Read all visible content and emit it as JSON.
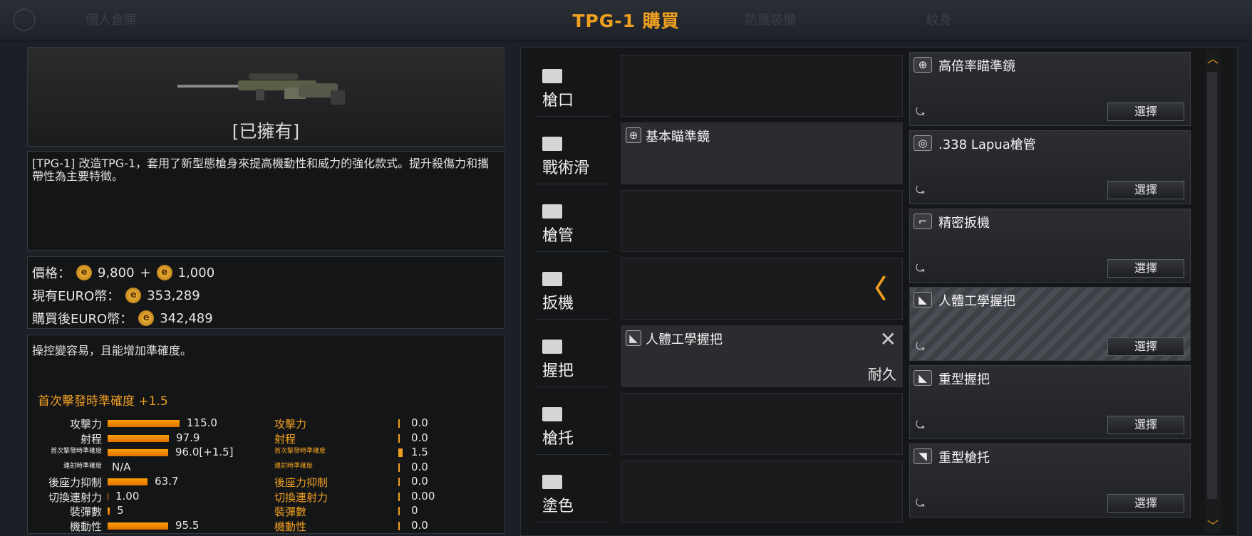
{
  "header": {
    "title": "TPG-1 購買",
    "ghost_tabs": [
      "個人倉庫",
      "防護裝備",
      "紋身"
    ]
  },
  "gun_preview": {
    "owned_label": "[已擁有]"
  },
  "description": "[TPG-1] 改造TPG-1，套用了新型態槍身來提高機動性和威力的強化款式。提升殺傷力和攜帶性為主要特徵。",
  "price": {
    "price_label": "價格：",
    "price_value": "9,800",
    "plus": "+",
    "extra_value": "1,000",
    "current_label": "現有EURO幣：",
    "current_value": "353,289",
    "after_label": "購買後EURO幣：",
    "after_value": "342,489",
    "coin_glyph": "e"
  },
  "effect": {
    "text": "操控變容易，且能增加準確度。",
    "bonus": "首次擊發時準確度 +1.5"
  },
  "stats": [
    {
      "label": "攻擊力",
      "value": "115.0",
      "bar": 0.9,
      "label2": "攻擊力",
      "value2": "0.0"
    },
    {
      "label": "射程",
      "value": "97.9",
      "bar": 0.77,
      "label2": "射程",
      "value2": "0.0"
    },
    {
      "label": "首次擊發時準確度",
      "value": "96.0[+1.5]",
      "bar": 0.76,
      "label2": "首次擊發時準確度",
      "value2": "1.5"
    },
    {
      "label": "連射時準確度",
      "value": "N/A",
      "bar": 0,
      "label2": "連射時準確度",
      "value2": "0.0"
    },
    {
      "label": "後座力抑制",
      "value": "63.7",
      "bar": 0.5,
      "label2": "後座力抑制",
      "value2": "0.0"
    },
    {
      "label": "切換連射力",
      "value": "1.00",
      "bar": 0.01,
      "label2": "切換連射力",
      "value2": "0.00"
    },
    {
      "label": "裝彈數",
      "value": "5",
      "bar": 0.03,
      "label2": "裝彈數",
      "value2": "0"
    },
    {
      "label": "機動性",
      "value": "95.5",
      "bar": 0.76,
      "label2": "機動性",
      "value2": "0.0"
    }
  ],
  "slots": [
    {
      "label": "槍口",
      "item": ""
    },
    {
      "label": "戰術滑",
      "item": "基本瞄準鏡"
    },
    {
      "label": "槍管",
      "item": ""
    },
    {
      "label": "扳機",
      "item": ""
    },
    {
      "label": "握把",
      "item": "人體工學握把",
      "durability": "耐久",
      "remove": "✕"
    },
    {
      "label": "槍托",
      "item": ""
    },
    {
      "label": "塗色",
      "item": ""
    }
  ],
  "arrow_glyph": "〈",
  "parts": [
    {
      "name": "高倍率瞄準鏡",
      "select": "選擇"
    },
    {
      "name": ".338 Lapua槍管",
      "select": "選擇"
    },
    {
      "name": "精密扳機",
      "select": "選擇"
    },
    {
      "name": "人體工學握把",
      "select": "選擇"
    },
    {
      "name": "重型握把",
      "select": "選擇"
    },
    {
      "name": "重型槍托",
      "select": "選擇"
    }
  ],
  "scroll": {
    "up": "︿",
    "down": "﹀"
  }
}
